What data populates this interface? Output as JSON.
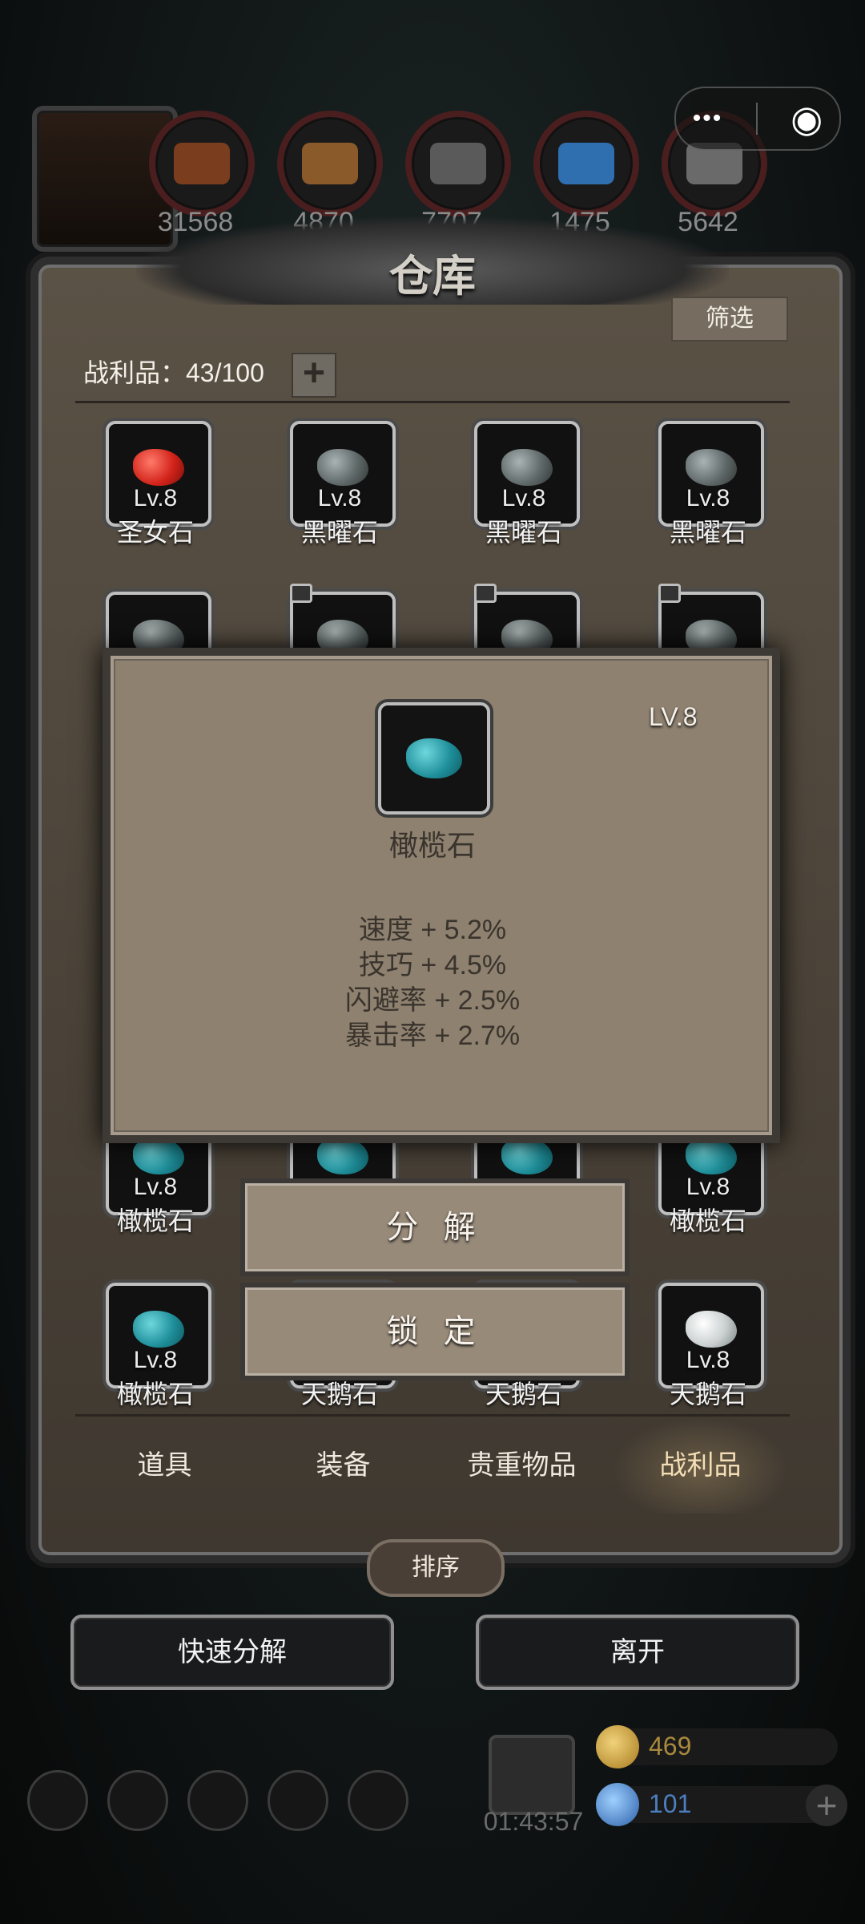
{
  "resources": [
    {
      "count": "31568",
      "icon": "meat-icon",
      "color": "#7a3e1f"
    },
    {
      "count": "4870",
      "icon": "wood-icon",
      "color": "#8a5a2b"
    },
    {
      "count": "7707",
      "icon": "stone-icon",
      "color": "#5a5a5a"
    },
    {
      "count": "1475",
      "icon": "crystal-icon",
      "color": "#2f6fb0"
    },
    {
      "count": "5642",
      "icon": "iron-icon",
      "color": "#6a6a6a"
    }
  ],
  "capsule": {
    "more_icon": "•••",
    "close_icon": "◉"
  },
  "panel": {
    "title": "仓库",
    "filter_label": "筛选",
    "loot_label": "战利品：43/100",
    "add_label": "+"
  },
  "grid": [
    {
      "lv": "Lv.8",
      "name": "圣女石",
      "color": "red",
      "locked": false
    },
    {
      "lv": "Lv.8",
      "name": "黑曜石",
      "color": "gray",
      "locked": false
    },
    {
      "lv": "Lv.8",
      "name": "黑曜石",
      "color": "gray",
      "locked": false
    },
    {
      "lv": "Lv.8",
      "name": "黑曜石",
      "color": "gray",
      "locked": false
    },
    {
      "lv": "",
      "name": "",
      "color": "gray",
      "locked": false
    },
    {
      "lv": "",
      "name": "",
      "color": "gray",
      "locked": true
    },
    {
      "lv": "",
      "name": "",
      "color": "gray",
      "locked": true
    },
    {
      "lv": "",
      "name": "",
      "color": "gray",
      "locked": true
    },
    {
      "lv": "Lv.8",
      "name": "橄榄石",
      "color": "teal",
      "locked": false
    },
    {
      "lv": "",
      "name": "",
      "color": "teal",
      "locked": false
    },
    {
      "lv": "",
      "name": "",
      "color": "teal",
      "locked": false
    },
    {
      "lv": "Lv.8",
      "name": "橄榄石",
      "color": "teal",
      "locked": false
    },
    {
      "lv": "Lv.8",
      "name": "橄榄石",
      "color": "teal",
      "locked": false
    },
    {
      "lv": "",
      "name": "天鹅石",
      "color": "white",
      "locked": false
    },
    {
      "lv": "",
      "name": "天鹅石",
      "color": "white",
      "locked": false
    },
    {
      "lv": "Lv.8",
      "name": "天鹅石",
      "color": "white",
      "locked": false
    }
  ],
  "tabs": [
    {
      "label": "道具",
      "active": false
    },
    {
      "label": "装备",
      "active": false
    },
    {
      "label": "贵重物品",
      "active": false
    },
    {
      "label": "战利品",
      "active": true
    }
  ],
  "sort_label": "排序",
  "quick_decompose_label": "快速分解",
  "leave_label": "离开",
  "popup": {
    "level": "LV.8",
    "name": "橄榄石",
    "stats": [
      "速度 + 5.2%",
      "技巧 + 4.5%",
      "闪避率 + 2.5%",
      "暴击率 + 2.7%"
    ],
    "decompose_label": "分 解",
    "lock_label": "锁 定"
  },
  "status": {
    "timer": "01:43:57",
    "gold": "469",
    "gems": "101",
    "gold_color": "#c6a14a",
    "gem_color": "#3f7fcf"
  }
}
